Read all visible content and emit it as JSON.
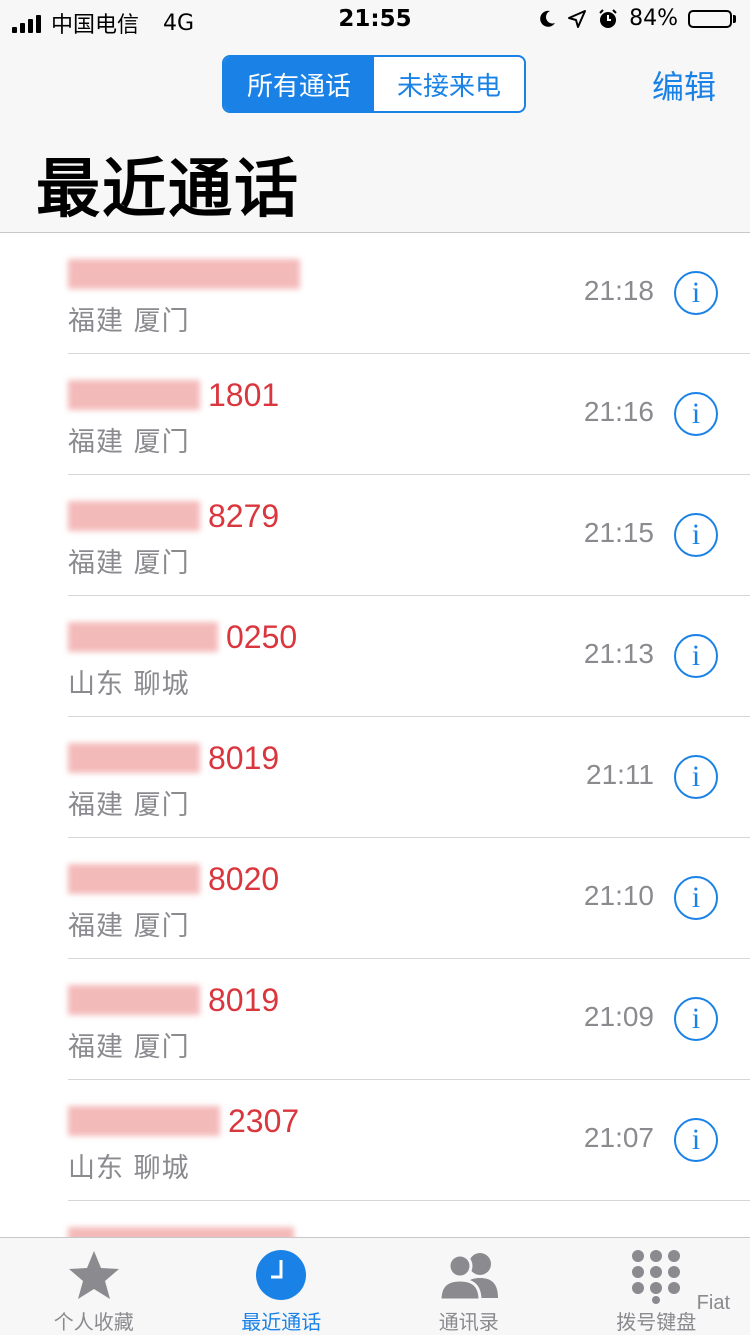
{
  "status_bar": {
    "carrier": "中国电信",
    "network": "4G",
    "time": "21:55",
    "battery": "84%",
    "battery_level": 0.84,
    "icons": [
      "moon-icon",
      "location-arrow-icon",
      "alarm-icon",
      "battery-icon"
    ]
  },
  "header": {
    "segments": [
      {
        "label": "所有通话",
        "active": true
      },
      {
        "label": "未接来电",
        "active": false
      }
    ],
    "edit_label": "编辑",
    "title": "最近通话"
  },
  "calls": [
    {
      "number_visible": "",
      "location": "福建 厦门",
      "time": "21:18"
    },
    {
      "number_visible": "1801",
      "location": "福建 厦门",
      "time": "21:16"
    },
    {
      "number_visible": "8279",
      "location": "福建 厦门",
      "time": "21:15"
    },
    {
      "number_visible": "0250",
      "location": "山东 聊城",
      "time": "21:13"
    },
    {
      "number_visible": "8019",
      "location": "福建 厦门",
      "time": "21:11"
    },
    {
      "number_visible": "8020",
      "location": "福建 厦门",
      "time": "21:10"
    },
    {
      "number_visible": "8019",
      "location": "福建 厦门",
      "time": "21:09"
    },
    {
      "number_visible": "2307",
      "location": "山东 聊城",
      "time": "21:07"
    },
    {
      "number_visible": "",
      "location": "",
      "time": ""
    }
  ],
  "info_glyph": "i",
  "colors": {
    "accent": "#1a82e6",
    "missed": "#d9363e",
    "secondary": "#8a8a8f"
  },
  "tab_bar": [
    {
      "label": "个人收藏",
      "icon": "star-icon",
      "active": false
    },
    {
      "label": "最近通话",
      "icon": "clock-icon",
      "active": true
    },
    {
      "label": "通讯录",
      "icon": "contacts-icon",
      "active": false
    },
    {
      "label": "拨号键盘",
      "icon": "keypad-icon",
      "active": false
    }
  ],
  "watermark": "Fiat"
}
